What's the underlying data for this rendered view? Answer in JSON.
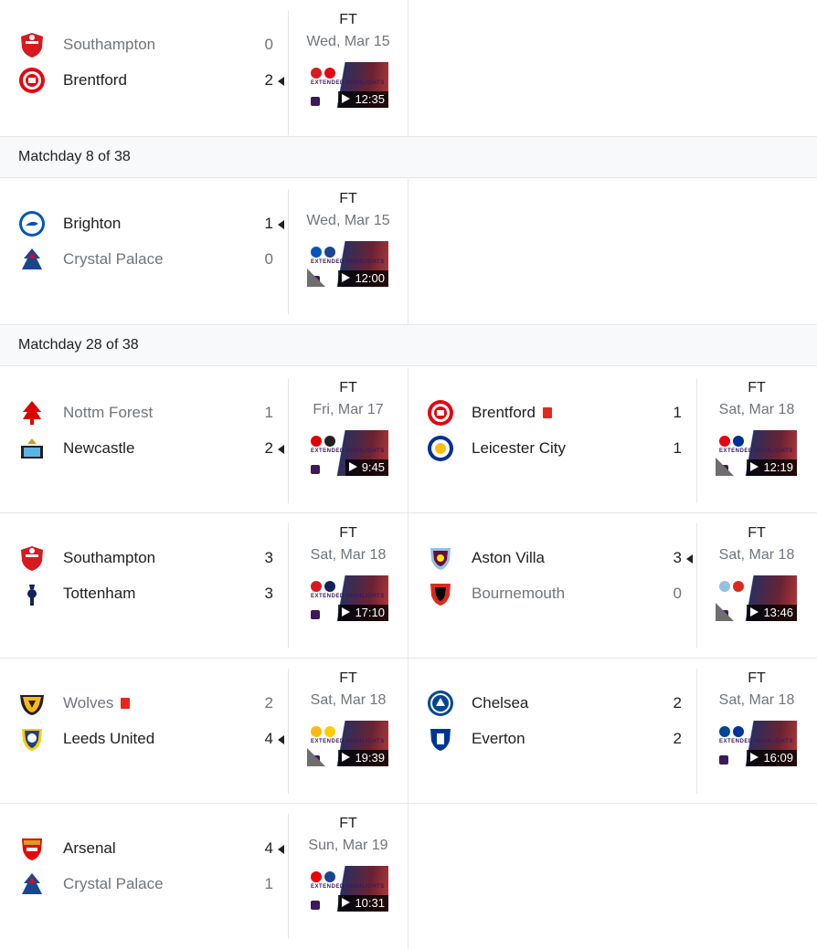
{
  "groups": [
    {
      "header": null,
      "matches": [
        {
          "home": {
            "name": "Southampton",
            "score": "0",
            "result": "lose",
            "red_card": false,
            "logo": "southampton-crest"
          },
          "away": {
            "name": "Brentford",
            "score": "2",
            "result": "win",
            "red_card": false,
            "logo": "brentford-crest"
          },
          "status": "FT",
          "date": "Wed, Mar 15",
          "duration": "12:35",
          "thumb_text": "EXTENDED HIGHLIGHTS",
          "corner": false
        }
      ]
    },
    {
      "header": "Matchday 8 of 38",
      "matches": [
        {
          "home": {
            "name": "Brighton",
            "score": "1",
            "result": "win",
            "red_card": false,
            "logo": "brighton-crest"
          },
          "away": {
            "name": "Crystal Palace",
            "score": "0",
            "result": "lose",
            "red_card": false,
            "logo": "crystal-palace-crest"
          },
          "status": "FT",
          "date": "Wed, Mar 15",
          "duration": "12:00",
          "thumb_text": "EXTENDED HIGHLIGHTS",
          "corner": true
        }
      ]
    },
    {
      "header": "Matchday 28 of 38",
      "matches": [
        {
          "home": {
            "name": "Nottm Forest",
            "score": "1",
            "result": "lose",
            "red_card": false,
            "logo": "nottm-forest-crest"
          },
          "away": {
            "name": "Newcastle",
            "score": "2",
            "result": "win",
            "red_card": false,
            "logo": "newcastle-crest"
          },
          "status": "FT",
          "date": "Fri, Mar 17",
          "duration": "9:45",
          "thumb_text": "EXTENDED HIGHLIGHTS",
          "corner": false
        },
        {
          "home": {
            "name": "Brentford",
            "score": "1",
            "result": "draw",
            "red_card": true,
            "logo": "brentford-crest"
          },
          "away": {
            "name": "Leicester City",
            "score": "1",
            "result": "draw",
            "red_card": false,
            "logo": "leicester-crest"
          },
          "status": "FT",
          "date": "Sat, Mar 18",
          "duration": "12:19",
          "thumb_text": "EXTENDED HIGHLIGHTS",
          "corner": true
        },
        {
          "home": {
            "name": "Southampton",
            "score": "3",
            "result": "draw",
            "red_card": false,
            "logo": "southampton-crest"
          },
          "away": {
            "name": "Tottenham",
            "score": "3",
            "result": "draw",
            "red_card": false,
            "logo": "tottenham-crest"
          },
          "status": "FT",
          "date": "Sat, Mar 18",
          "duration": "17:10",
          "thumb_text": "EXTENDED HIGHLIGHTS",
          "corner": false
        },
        {
          "home": {
            "name": "Aston Villa",
            "score": "3",
            "result": "win",
            "red_card": false,
            "logo": "aston-villa-crest"
          },
          "away": {
            "name": "Bournemouth",
            "score": "0",
            "result": "lose",
            "red_card": false,
            "logo": "bournemouth-crest"
          },
          "status": "FT",
          "date": "Sat, Mar 18",
          "duration": "13:46",
          "thumb_text": "",
          "corner": true
        },
        {
          "home": {
            "name": "Wolves",
            "score": "2",
            "result": "lose",
            "red_card": true,
            "logo": "wolves-crest"
          },
          "away": {
            "name": "Leeds United",
            "score": "4",
            "result": "win",
            "red_card": false,
            "logo": "leeds-crest"
          },
          "status": "FT",
          "date": "Sat, Mar 18",
          "duration": "19:39",
          "thumb_text": "EXTENDED HIGHLIGHTS",
          "corner": true
        },
        {
          "home": {
            "name": "Chelsea",
            "score": "2",
            "result": "draw",
            "red_card": false,
            "logo": "chelsea-crest"
          },
          "away": {
            "name": "Everton",
            "score": "2",
            "result": "draw",
            "red_card": false,
            "logo": "everton-crest"
          },
          "status": "FT",
          "date": "Sat, Mar 18",
          "duration": "16:09",
          "thumb_text": "EXTENDED HIGHLIGHTS",
          "corner": false
        },
        {
          "home": {
            "name": "Arsenal",
            "score": "4",
            "result": "win",
            "red_card": false,
            "logo": "arsenal-crest"
          },
          "away": {
            "name": "Crystal Palace",
            "score": "1",
            "result": "lose",
            "red_card": false,
            "logo": "crystal-palace-crest"
          },
          "status": "FT",
          "date": "Sun, Mar 19",
          "duration": "10:31",
          "thumb_text": "EXTENDED HIGHLIGHTS",
          "corner": false
        }
      ]
    }
  ],
  "colors": {
    "southampton-crest": "#d71920",
    "brentford-crest": "#e30613",
    "brighton-crest": "#0057b8",
    "crystal-palace-crest": "#1b458f",
    "nottm-forest-crest": "#dd0000",
    "newcastle-crest": "#241f20",
    "leicester-crest": "#003090",
    "tottenham-crest": "#132257",
    "aston-villa-crest": "#95bfe5",
    "bournemouth-crest": "#da291c",
    "wolves-crest": "#fdb913",
    "leeds-crest": "#ffcd00",
    "chelsea-crest": "#034694",
    "everton-crest": "#003399",
    "arsenal-crest": "#ef0107",
    "red-card": "#e8261c"
  }
}
